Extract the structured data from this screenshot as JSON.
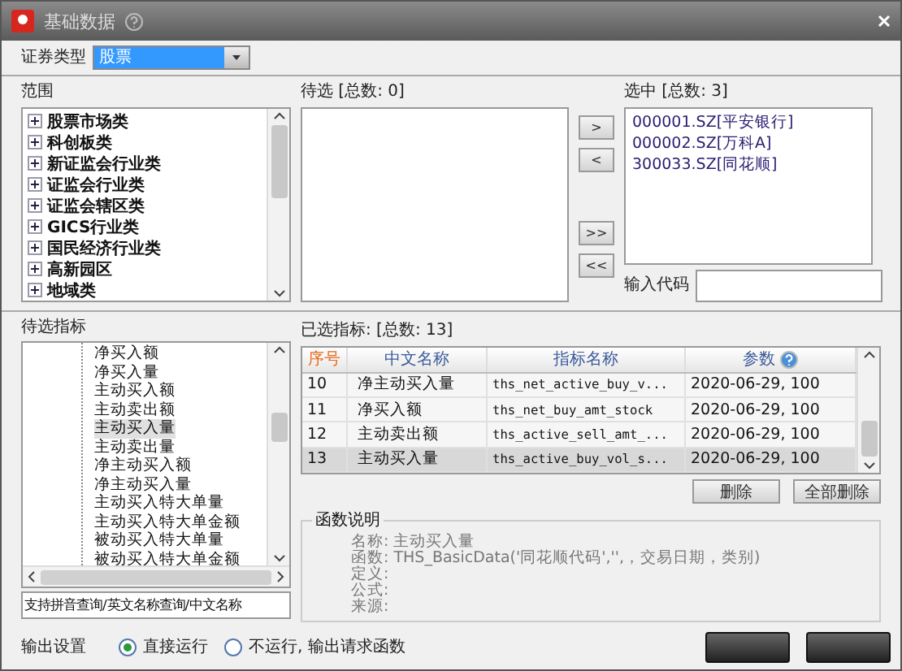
{
  "window": {
    "title": "基础数据"
  },
  "security_type": {
    "label": "证券类型",
    "value": "股票"
  },
  "scope": {
    "label": "范围",
    "items": [
      {
        "label": "股票市场类",
        "expanded": false
      },
      {
        "label": "科创板类",
        "expanded": false
      },
      {
        "label": "新证监会行业类",
        "expanded": false
      },
      {
        "label": "证监会行业类",
        "expanded": false
      },
      {
        "label": "证监会辖区类",
        "expanded": false
      },
      {
        "label": "GICS行业类",
        "expanded": false
      },
      {
        "label": "国民经济行业类",
        "expanded": false
      },
      {
        "label": "高新园区",
        "expanded": false
      },
      {
        "label": "地域类",
        "expanded": false
      }
    ]
  },
  "candidates": {
    "label": "待选 [总数: 0]"
  },
  "transfer_buttons": [
    ">",
    "<",
    ">>",
    "<<"
  ],
  "chosen": {
    "label": "选中 [总数: 3]",
    "items": [
      "000001.SZ[平安银行]",
      "000002.SZ[万科A]",
      "300033.SZ[同花顺]"
    ]
  },
  "code_input": {
    "label": "输入代码"
  },
  "indicators": {
    "label": "待选指标",
    "items": [
      {
        "label": "净买入额",
        "selected": false
      },
      {
        "label": "净买入量",
        "selected": false
      },
      {
        "label": "主动买入额",
        "selected": false
      },
      {
        "label": "主动卖出额",
        "selected": false
      },
      {
        "label": "主动买入量",
        "selected": true
      },
      {
        "label": "主动卖出量",
        "selected": false
      },
      {
        "label": "净主动买入额",
        "selected": false
      },
      {
        "label": "净主动买入量",
        "selected": false
      },
      {
        "label": "主动买入特大单量",
        "selected": false
      },
      {
        "label": "主动买入特大单金额",
        "selected": false
      },
      {
        "label": "被动买入特大单量",
        "selected": false
      },
      {
        "label": "被动买入特大单金额",
        "selected": false
      }
    ],
    "search": {
      "value": "支持拼音查询/英文名称查询/中文名称"
    }
  },
  "selected_indicators": {
    "label": "已选指标: [总数: 13]",
    "columns": [
      "序号",
      "中文名称",
      "指标名称",
      "参数"
    ],
    "rows": [
      {
        "cells": [
          "10",
          "净主动买入量",
          "ths_net_active_buy_v...",
          "2020-06-29, 100"
        ],
        "selected": false
      },
      {
        "cells": [
          "11",
          "净买入额",
          "ths_net_buy_amt_stock",
          "2020-06-29, 100"
        ],
        "selected": false
      },
      {
        "cells": [
          "12",
          "主动卖出额",
          "ths_active_sell_amt_...",
          "2020-06-29, 100"
        ],
        "selected": false
      },
      {
        "cells": [
          "13",
          "主动买入量",
          "ths_active_buy_vol_s...",
          "2020-06-29, 100"
        ],
        "selected": true
      }
    ]
  },
  "buttons": [
    "删除",
    "全部删除"
  ],
  "description": {
    "title": "函数说明",
    "lines": [
      "名称: 主动买入量",
      "函数: THS_BasicData('同花顺代码','',，交易日期，类别)",
      "定义:",
      "公式:",
      "来源:"
    ]
  },
  "output": {
    "label": "输出设置",
    "options": [
      {
        "label": "直接运行",
        "selected": true
      },
      {
        "label": "不运行, 输出请求函数",
        "selected": false
      }
    ]
  }
}
